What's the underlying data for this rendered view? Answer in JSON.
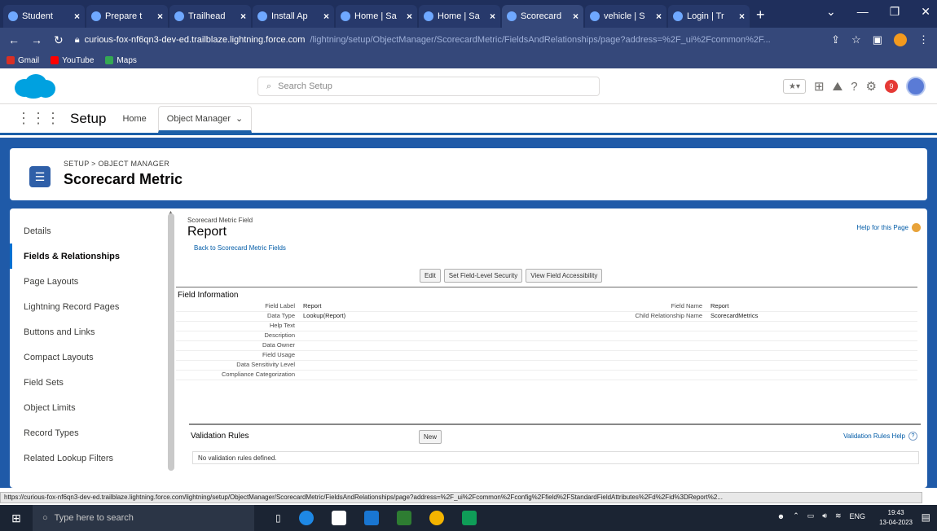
{
  "browser": {
    "tabs": [
      {
        "label": "Student"
      },
      {
        "label": "Prepare t"
      },
      {
        "label": "Trailhead"
      },
      {
        "label": "Install Ap"
      },
      {
        "label": "Home | Sa"
      },
      {
        "label": "Home | Sa"
      },
      {
        "label": "Scorecard"
      },
      {
        "label": "vehicle | S"
      },
      {
        "label": "Login | Tr"
      }
    ],
    "new_tab": "+",
    "url_host": "curious-fox-nf6qn3-dev-ed.trailblaze.lightning.force.com",
    "url_path": "/lightning/setup/ObjectManager/ScorecardMetric/FieldsAndRelationships/page?address=%2F_ui%2Fcommon%2F...",
    "bookmarks": [
      {
        "label": "Gmail",
        "color": "#d93025"
      },
      {
        "label": "YouTube",
        "color": "#ff0000"
      },
      {
        "label": "Maps",
        "color": "#34a853"
      }
    ]
  },
  "header": {
    "search_placeholder": "Search Setup",
    "notification_count": "9"
  },
  "nav": {
    "app_name": "Setup",
    "home": "Home",
    "object_manager": "Object Manager"
  },
  "object": {
    "breadcrumb": "SETUP > OBJECT MANAGER",
    "title": "Scorecard Metric"
  },
  "sidebar": {
    "items": [
      {
        "label": "Details"
      },
      {
        "label": "Fields & Relationships"
      },
      {
        "label": "Page Layouts"
      },
      {
        "label": "Lightning Record Pages"
      },
      {
        "label": "Buttons and Links"
      },
      {
        "label": "Compact Layouts"
      },
      {
        "label": "Field Sets"
      },
      {
        "label": "Object Limits"
      },
      {
        "label": "Record Types"
      },
      {
        "label": "Related Lookup Filters"
      }
    ]
  },
  "field_page": {
    "caption": "Scorecard Metric Field",
    "title": "Report",
    "back_link": "Back to Scorecard Metric Fields",
    "help_link": "Help for this Page",
    "buttons": {
      "edit": "Edit",
      "fls": "Set Field-Level Security",
      "access": "View Field Accessibility"
    },
    "section_title": "Field Information",
    "rows": [
      {
        "l1": "Field Label",
        "v1": "Report",
        "l2": "Field Name",
        "v2": "Report"
      },
      {
        "l1": "Data Type",
        "v1": "Lookup(Report)",
        "l2": "Child Relationship Name",
        "v2": "ScorecardMetrics"
      },
      {
        "l1": "Help Text",
        "v1": "",
        "l2": "",
        "v2": ""
      },
      {
        "l1": "Description",
        "v1": "",
        "l2": "",
        "v2": ""
      },
      {
        "l1": "Data Owner",
        "v1": "",
        "l2": "",
        "v2": ""
      },
      {
        "l1": "Field Usage",
        "v1": "",
        "l2": "",
        "v2": ""
      },
      {
        "l1": "Data Sensitivity Level",
        "v1": "",
        "l2": "",
        "v2": ""
      },
      {
        "l1": "Compliance Categorization",
        "v1": "",
        "l2": "",
        "v2": ""
      }
    ]
  },
  "validation": {
    "title": "Validation Rules",
    "new_button": "New",
    "help": "Validation Rules Help",
    "empty": "No validation rules defined."
  },
  "status_url": "https://curious-fox-nf6qn3-dev-ed.trailblaze.lightning.force.com/lightning/setup/ObjectManager/ScorecardMetric/FieldsAndRelationships/page?address=%2F_ui%2Fcommon%2Fconfig%2Ffield%2FStandardFieldAttributes%2Fd%2Fid%3DReport%2...",
  "taskbar": {
    "search_placeholder": "Type here to search",
    "lang": "ENG",
    "time": "19:43",
    "date": "13-04-2023"
  }
}
